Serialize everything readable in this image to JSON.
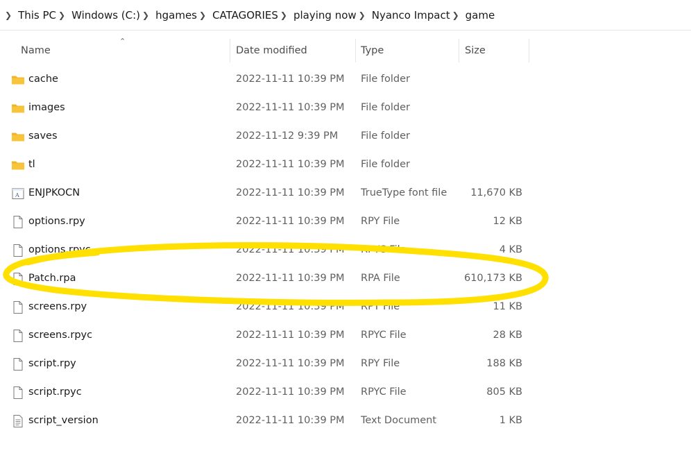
{
  "breadcrumb": [
    "This PC",
    "Windows (C:)",
    "hgames",
    "CATAGORIES",
    "playing now",
    "Nyanco Impact",
    "game"
  ],
  "columns": {
    "name": "Name",
    "date": "Date modified",
    "type": "Type",
    "size": "Size"
  },
  "files": [
    {
      "name": "cache",
      "date": "2022-11-11 10:39 PM",
      "type": "File folder",
      "size": "",
      "icon": "folder-icon"
    },
    {
      "name": "images",
      "date": "2022-11-11 10:39 PM",
      "type": "File folder",
      "size": "",
      "icon": "folder-icon"
    },
    {
      "name": "saves",
      "date": "2022-11-12 9:39 PM",
      "type": "File folder",
      "size": "",
      "icon": "folder-icon"
    },
    {
      "name": "tl",
      "date": "2022-11-11 10:39 PM",
      "type": "File folder",
      "size": "",
      "icon": "folder-icon"
    },
    {
      "name": "ENJPKOCN",
      "date": "2022-11-11 10:39 PM",
      "type": "TrueType font file",
      "size": "11,670 KB",
      "icon": "font-file-icon"
    },
    {
      "name": "options.rpy",
      "date": "2022-11-11 10:39 PM",
      "type": "RPY File",
      "size": "12 KB",
      "icon": "file-icon"
    },
    {
      "name": "options.rpyc",
      "date": "2022-11-11 10:39 PM",
      "type": "RPYC File",
      "size": "4 KB",
      "icon": "file-icon"
    },
    {
      "name": "Patch.rpa",
      "date": "2022-11-11 10:39 PM",
      "type": "RPA File",
      "size": "610,173 KB",
      "icon": "file-icon"
    },
    {
      "name": "screens.rpy",
      "date": "2022-11-11 10:39 PM",
      "type": "RPY File",
      "size": "11 KB",
      "icon": "file-icon"
    },
    {
      "name": "screens.rpyc",
      "date": "2022-11-11 10:39 PM",
      "type": "RPYC File",
      "size": "28 KB",
      "icon": "file-icon"
    },
    {
      "name": "script.rpy",
      "date": "2022-11-11 10:39 PM",
      "type": "RPY File",
      "size": "188 KB",
      "icon": "file-icon"
    },
    {
      "name": "script.rpyc",
      "date": "2022-11-11 10:39 PM",
      "type": "RPYC File",
      "size": "805 KB",
      "icon": "file-icon"
    },
    {
      "name": "script_version",
      "date": "2022-11-11 10:39 PM",
      "type": "Text Document",
      "size": "1 KB",
      "icon": "text-file-icon"
    }
  ],
  "colors": {
    "folder": "#f8c43a",
    "highlight": "#ffe000"
  }
}
